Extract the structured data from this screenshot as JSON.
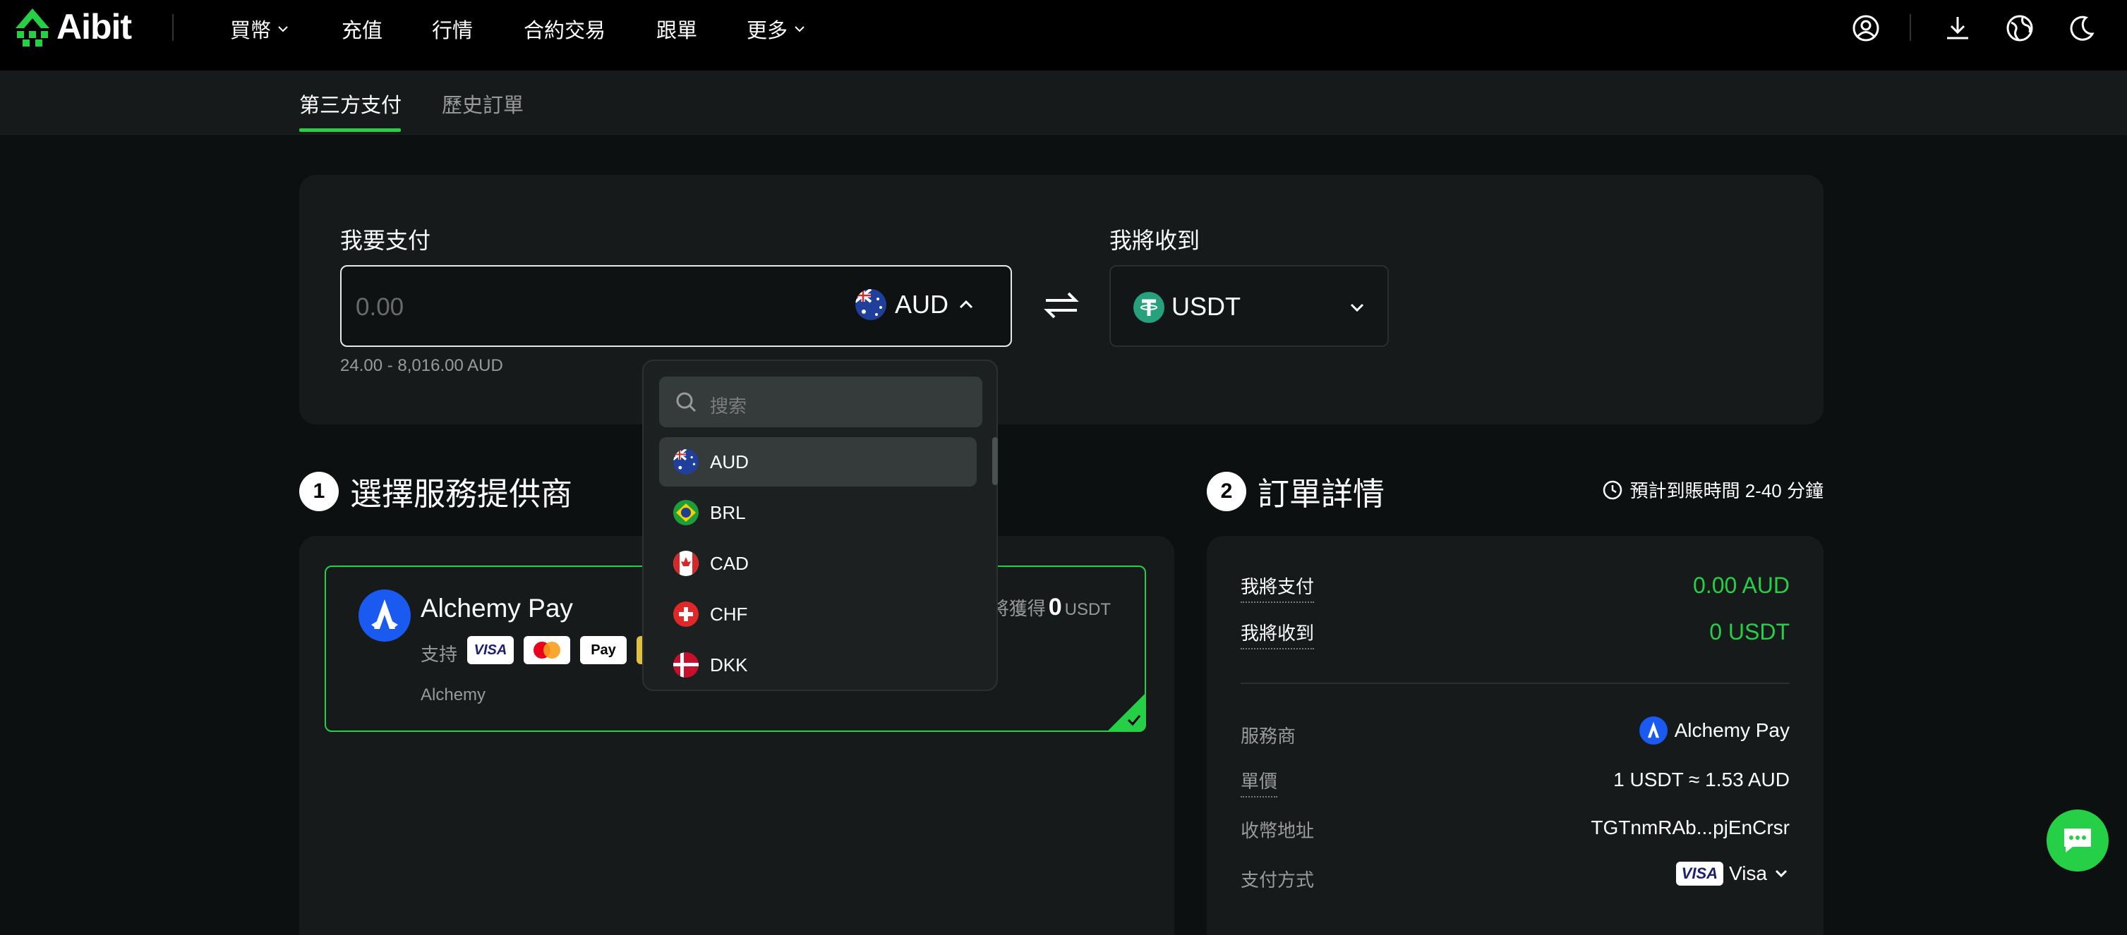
{
  "header": {
    "logo_text": "Aibit",
    "nav": [
      {
        "label": "買幣",
        "has_dropdown": true
      },
      {
        "label": "充值",
        "has_dropdown": false
      },
      {
        "label": "行情",
        "has_dropdown": false
      },
      {
        "label": "合約交易",
        "has_dropdown": false
      },
      {
        "label": "跟單",
        "has_dropdown": false
      },
      {
        "label": "更多",
        "has_dropdown": true
      }
    ],
    "icons": [
      "user-icon",
      "download-icon",
      "globe-icon",
      "moon-icon"
    ]
  },
  "subnav": {
    "tabs": [
      {
        "label": "第三方支付",
        "active": true
      },
      {
        "label": "歷史訂單",
        "active": false
      }
    ]
  },
  "exchange": {
    "pay_label": "我要支付",
    "pay_placeholder": "0.00",
    "pay_currency": "AUD",
    "range": "24.00 - 8,016.00 AUD",
    "receive_label": "我將收到",
    "receive_currency": "USDT"
  },
  "currency_dropdown": {
    "search_placeholder": "搜索",
    "options": [
      {
        "code": "AUD",
        "selected": true
      },
      {
        "code": "BRL",
        "selected": false
      },
      {
        "code": "CAD",
        "selected": false
      },
      {
        "code": "CHF",
        "selected": false
      },
      {
        "code": "DKK",
        "selected": false
      }
    ]
  },
  "providers_section": {
    "step": "1",
    "title": "選擇服務提供商",
    "card": {
      "name": "Alchemy Pay",
      "support_label": "支持",
      "receive_prefix": "將獲得",
      "receive_amount": "0",
      "receive_unit": "USDT",
      "sub_label": "Alchemy",
      "pay_methods": [
        "VISA",
        "Mastercard",
        "Apple Pay"
      ]
    }
  },
  "order_section": {
    "step": "2",
    "title": "訂單詳情",
    "eta": "預計到賬時間 2-40 分鐘",
    "pay_label": "我將支付",
    "pay_value": "0.00 AUD",
    "receive_label": "我將收到",
    "receive_value": "0 USDT",
    "rows": [
      {
        "label": "服務商",
        "value": "Alchemy Pay"
      },
      {
        "label": "單價",
        "value": "1 USDT ≈ 1.53 AUD"
      },
      {
        "label": "收幣地址",
        "value": "TGTnmRAb...pjEnCrsr"
      },
      {
        "label": "支付方式",
        "value": "Visa"
      }
    ],
    "pay_method_badge": "VISA"
  },
  "colors": {
    "accent": "#25d046",
    "background": "#0c1010",
    "panel": "#171a1a"
  }
}
